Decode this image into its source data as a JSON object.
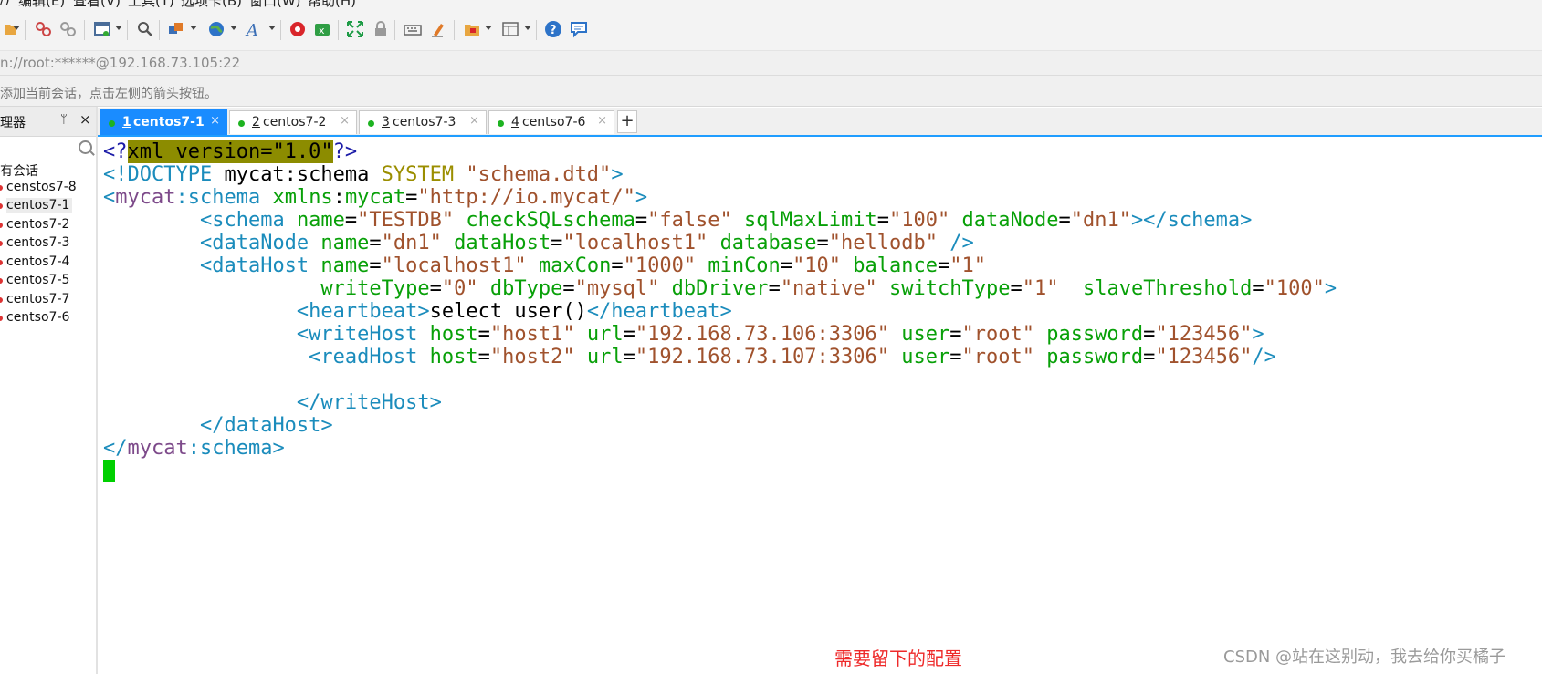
{
  "menubar": {
    "items": [
      "/)",
      "编辑(E)",
      "查看(V)",
      "工具(T)",
      "选项卡(B)",
      "窗口(W)",
      "帮助(H)"
    ]
  },
  "toolbar": {
    "icons": [
      "new-session-icon",
      "properties-icon",
      "disconnect-icon",
      "new-window-icon",
      "find-icon",
      "compose-icon",
      "globe-icon",
      "font-icon",
      "xftp-icon",
      "xshell-icon",
      "fullscreen-icon",
      "lock-icon",
      "keyboard-icon",
      "highlight-icon",
      "folder-icon",
      "layout-icon",
      "help-icon",
      "chat-icon"
    ]
  },
  "address": {
    "text": "n://root:******@192.168.73.105:22"
  },
  "hint": {
    "text": "添加当前会话，点击左侧的箭头按钮。"
  },
  "session_panel": {
    "title": "理器",
    "pin": "ᛘ",
    "close": "×",
    "root": "有会话",
    "items": [
      "censtos7-8",
      "centos7-1",
      "centos7-2",
      "centos7-3",
      "centos7-4",
      "centos7-5",
      "centos7-7",
      "centso7-6"
    ]
  },
  "tabs": [
    {
      "num": "1",
      "name": "centos7-1",
      "close": "×"
    },
    {
      "num": "2",
      "name": "centos7-2",
      "close": "×"
    },
    {
      "num": "3",
      "name": "centos7-3",
      "close": "×"
    },
    {
      "num": "4",
      "name": "centso7-6",
      "close": "×"
    }
  ],
  "tab_add": "+",
  "terminal": {
    "colors": {
      "tag": "#1b8cbc",
      "attr": "#08a008",
      "value": "#a0522d",
      "cursor": "#00d000"
    },
    "lines": [
      {
        "s": [
          [
            "pu",
            "<?"
          ],
          [
            "hi",
            "xml version=\"1.0\""
          ],
          [
            "pu",
            "?>"
          ]
        ]
      },
      {
        "s": [
          [
            "tg",
            "<!DOCTYPE "
          ],
          [
            "tx",
            "mycat:schema "
          ],
          [
            "ky",
            "SYSTEM "
          ],
          [
            "va",
            "\"schema.dtd\""
          ],
          [
            "tg",
            ">"
          ]
        ]
      },
      {
        "s": [
          [
            "tg",
            "<"
          ],
          [
            "pf",
            "mycat"
          ],
          [
            "tg",
            ":schema "
          ],
          [
            "at",
            "xmlns"
          ],
          [
            "tx",
            ":"
          ],
          [
            "at",
            "mycat"
          ],
          [
            "tx",
            "="
          ],
          [
            "va",
            "\"http://io.mycat/\""
          ],
          [
            "tg",
            ">"
          ]
        ]
      },
      {
        "s": [
          [
            "tx",
            "        "
          ],
          [
            "tg",
            "<schema "
          ],
          [
            "at",
            "name"
          ],
          [
            "tx",
            "="
          ],
          [
            "va",
            "\"TESTDB\""
          ],
          [
            "tx",
            " "
          ],
          [
            "at",
            "checkSQLschema"
          ],
          [
            "tx",
            "="
          ],
          [
            "va",
            "\"false\""
          ],
          [
            "tx",
            " "
          ],
          [
            "at",
            "sqlMaxLimit"
          ],
          [
            "tx",
            "="
          ],
          [
            "va",
            "\"100\""
          ],
          [
            "tx",
            " "
          ],
          [
            "at",
            "dataNode"
          ],
          [
            "tx",
            "="
          ],
          [
            "va",
            "\"dn1\""
          ],
          [
            "tg",
            "></schema>"
          ]
        ]
      },
      {
        "s": [
          [
            "tx",
            "        "
          ],
          [
            "tg",
            "<dataNode "
          ],
          [
            "at",
            "name"
          ],
          [
            "tx",
            "="
          ],
          [
            "va",
            "\"dn1\""
          ],
          [
            "tx",
            " "
          ],
          [
            "at",
            "dataHost"
          ],
          [
            "tx",
            "="
          ],
          [
            "va",
            "\"localhost1\""
          ],
          [
            "tx",
            " "
          ],
          [
            "at",
            "database"
          ],
          [
            "tx",
            "="
          ],
          [
            "va",
            "\"hellodb\""
          ],
          [
            "tx",
            " "
          ],
          [
            "tg",
            "/>"
          ]
        ]
      },
      {
        "s": [
          [
            "tx",
            "        "
          ],
          [
            "tg",
            "<dataHost "
          ],
          [
            "at",
            "name"
          ],
          [
            "tx",
            "="
          ],
          [
            "va",
            "\"localhost1\""
          ],
          [
            "tx",
            " "
          ],
          [
            "at",
            "maxCon"
          ],
          [
            "tx",
            "="
          ],
          [
            "va",
            "\"1000\""
          ],
          [
            "tx",
            " "
          ],
          [
            "at",
            "minCon"
          ],
          [
            "tx",
            "="
          ],
          [
            "va",
            "\"10\""
          ],
          [
            "tx",
            " "
          ],
          [
            "at",
            "balance"
          ],
          [
            "tx",
            "="
          ],
          [
            "va",
            "\"1\""
          ]
        ]
      },
      {
        "s": [
          [
            "tx",
            "                  "
          ],
          [
            "at",
            "writeType"
          ],
          [
            "tx",
            "="
          ],
          [
            "va",
            "\"0\""
          ],
          [
            "tx",
            " "
          ],
          [
            "at",
            "dbType"
          ],
          [
            "tx",
            "="
          ],
          [
            "va",
            "\"mysql\""
          ],
          [
            "tx",
            " "
          ],
          [
            "at",
            "dbDriver"
          ],
          [
            "tx",
            "="
          ],
          [
            "va",
            "\"native\""
          ],
          [
            "tx",
            " "
          ],
          [
            "at",
            "switchType"
          ],
          [
            "tx",
            "="
          ],
          [
            "va",
            "\"1\""
          ],
          [
            "tx",
            "  "
          ],
          [
            "at",
            "slaveThreshold"
          ],
          [
            "tx",
            "="
          ],
          [
            "va",
            "\"100\""
          ],
          [
            "tg",
            ">"
          ]
        ]
      },
      {
        "s": [
          [
            "tx",
            "                "
          ],
          [
            "tg",
            "<heartbeat>"
          ],
          [
            "tx",
            "select user()"
          ],
          [
            "tg",
            "</heartbeat>"
          ]
        ]
      },
      {
        "s": [
          [
            "tx",
            "                "
          ],
          [
            "tg",
            "<writeHost "
          ],
          [
            "at",
            "host"
          ],
          [
            "tx",
            "="
          ],
          [
            "va",
            "\"host1\""
          ],
          [
            "tx",
            " "
          ],
          [
            "at",
            "url"
          ],
          [
            "tx",
            "="
          ],
          [
            "va",
            "\"192.168.73.106:3306\""
          ],
          [
            "tx",
            " "
          ],
          [
            "at",
            "user"
          ],
          [
            "tx",
            "="
          ],
          [
            "va",
            "\"root\""
          ],
          [
            "tx",
            " "
          ],
          [
            "at",
            "password"
          ],
          [
            "tx",
            "="
          ],
          [
            "va",
            "\"123456\""
          ],
          [
            "tg",
            ">"
          ]
        ]
      },
      {
        "s": [
          [
            "tx",
            "                 "
          ],
          [
            "tg",
            "<readHost "
          ],
          [
            "at",
            "host"
          ],
          [
            "tx",
            "="
          ],
          [
            "va",
            "\"host2\""
          ],
          [
            "tx",
            " "
          ],
          [
            "at",
            "url"
          ],
          [
            "tx",
            "="
          ],
          [
            "va",
            "\"192.168.73.107:3306\""
          ],
          [
            "tx",
            " "
          ],
          [
            "at",
            "user"
          ],
          [
            "tx",
            "="
          ],
          [
            "va",
            "\"root\""
          ],
          [
            "tx",
            " "
          ],
          [
            "at",
            "password"
          ],
          [
            "tx",
            "="
          ],
          [
            "va",
            "\"123456\""
          ],
          [
            "tg",
            "/>"
          ]
        ]
      },
      {
        "s": []
      },
      {
        "s": [
          [
            "tx",
            "                "
          ],
          [
            "tg",
            "</writeHost>"
          ]
        ]
      },
      {
        "s": [
          [
            "tx",
            "        "
          ],
          [
            "tg",
            "</dataHost>"
          ]
        ]
      },
      {
        "s": [
          [
            "tg",
            "</"
          ],
          [
            "pf",
            "mycat"
          ],
          [
            "tg",
            ":schema>"
          ]
        ]
      },
      {
        "s": [],
        "cursor": true
      }
    ]
  },
  "note": "需要留下的配置",
  "watermark": "CSDN @站在这别动，我去给你买橘子"
}
